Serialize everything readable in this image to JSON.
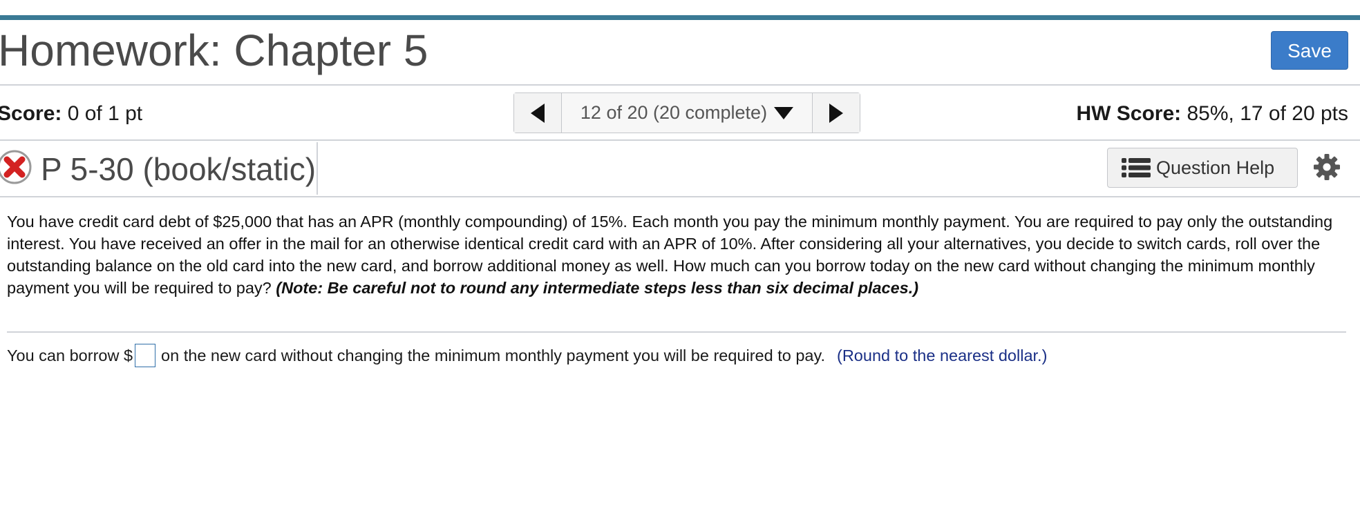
{
  "header": {
    "title": "Homework: Chapter 5",
    "save_label": "Save"
  },
  "score_bar": {
    "score_label": "Score:",
    "score_value": "0 of 1 pt",
    "pager_text": "12 of 20 (20 complete)",
    "hw_score_label": "HW Score:",
    "hw_score_value": "85%, 17 of 20 pts"
  },
  "question_header": {
    "status": "incorrect",
    "question_id": "P 5-30 (book/static)",
    "help_label": "Question Help"
  },
  "question": {
    "body": "You have credit card debt of $25,000 that has an APR (monthly compounding) of 15%. Each month you pay the minimum monthly payment. You are required to pay only the outstanding interest. You have received an offer in the mail for an otherwise identical credit card with an APR of 10%. After considering all your alternatives, you decide to switch cards, roll over the outstanding balance on the old card into the new card, and borrow additional money as well. How much can you borrow today on the new card without changing the minimum monthly payment you will be required to pay?",
    "note": "(Note: Be careful not to round any intermediate steps less than six decimal places.)"
  },
  "answer": {
    "prefix": "You can borrow $",
    "input_value": "",
    "suffix": "on the new card without changing the minimum monthly payment you will be required to pay.",
    "rounding_note": "(Round to the nearest dollar.)"
  },
  "colors": {
    "top_bar": "#3a7a95",
    "save_button": "#3b7cc9",
    "incorrect_icon": "#c62828",
    "rounding_note": "#1a2f86"
  }
}
